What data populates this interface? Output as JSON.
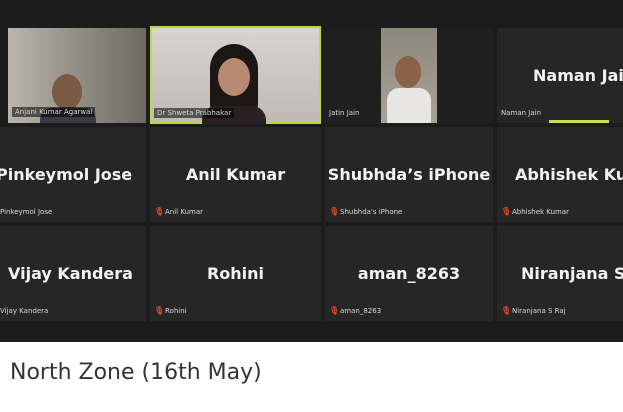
{
  "participants": [
    {
      "display": "",
      "label": "Anjani Kumar Agarwal",
      "mic_off": false
    },
    {
      "display": "",
      "label": "Dr Shweta Prabhakar",
      "mic_off": false
    },
    {
      "display": "",
      "label": "Jatin Jain",
      "mic_off": false
    },
    {
      "display": "Naman Jain",
      "label": "Naman Jain",
      "mic_off": false
    },
    {
      "display": "Pinkeymol Jose",
      "label": "Pinkeymol Jose",
      "mic_off": false
    },
    {
      "display": "Anil Kumar",
      "label": "Anil Kumar",
      "mic_off": true
    },
    {
      "display": "Shubhda’s iPhone",
      "label": "Shubhda's iPhone",
      "mic_off": true
    },
    {
      "display": "Abhishek Kumar",
      "label": "Abhishek Kumar",
      "mic_off": true
    },
    {
      "display": "Vijay Kandera",
      "label": "Vijay Kandera",
      "mic_off": false
    },
    {
      "display": "Rohini",
      "label": "Rohini",
      "mic_off": true
    },
    {
      "display": "aman_8263",
      "label": "aman_8263",
      "mic_off": true
    },
    {
      "display": "Niranjana S Raj",
      "label": "Niranjana S Raj",
      "mic_off": true
    }
  ],
  "caption": "North Zone (16th May)",
  "colors": {
    "active_speaker": "#b8d94a",
    "mic_off": "#e0442a",
    "tile_bg": "#262626"
  },
  "icons": {
    "mic_off": "muted-mic-icon"
  }
}
